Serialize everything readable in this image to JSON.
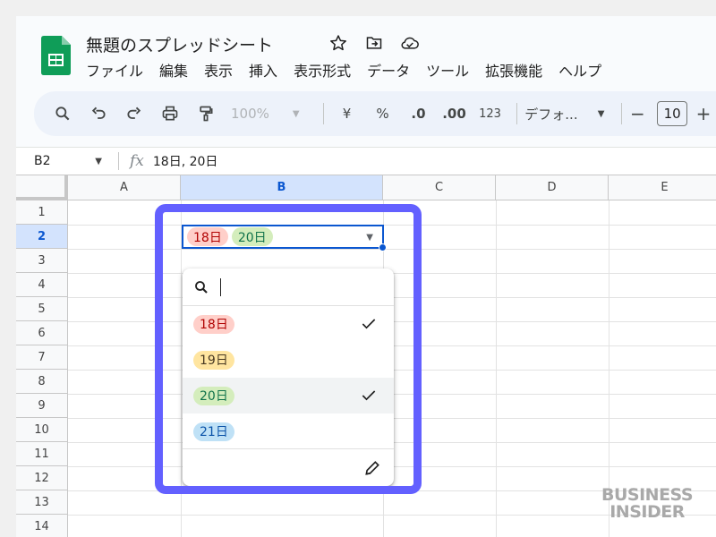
{
  "app": {
    "title": "無題のスプレッドシート",
    "menu": [
      "ファイル",
      "編集",
      "表示",
      "挿入",
      "表示形式",
      "データ",
      "ツール",
      "拡張機能",
      "ヘルプ"
    ]
  },
  "toolbar": {
    "zoom": "100%",
    "currency": "¥",
    "percent": "%",
    "dec_decrease": ".0",
    "dec_increase": ".00",
    "number_format": "123",
    "font": "デフォ...",
    "font_size": "10",
    "minus": "−",
    "plus": "+"
  },
  "formula_bar": {
    "cell_ref": "B2",
    "fx": "fx",
    "value": "18日, 20日"
  },
  "grid": {
    "columns": [
      "A",
      "B",
      "C",
      "D",
      "E"
    ],
    "rows": [
      "1",
      "2",
      "3",
      "4",
      "5",
      "6",
      "7",
      "8",
      "9",
      "10",
      "11",
      "12",
      "13",
      "14"
    ],
    "selected_column": "B",
    "selected_row": "2"
  },
  "cell_b2": {
    "chips": [
      "18日",
      "20日"
    ]
  },
  "dropdown": {
    "options": [
      {
        "label": "18日",
        "color": "#ffcfc9",
        "checked": true
      },
      {
        "label": "19日",
        "color": "#ffe5a0",
        "checked": false
      },
      {
        "label": "20日",
        "color": "#d4edbc",
        "checked": true
      },
      {
        "label": "21日",
        "color": "#bfe1f6",
        "checked": false
      }
    ]
  },
  "colors": {
    "accent": "#0b57d0",
    "highlight_frame": "#6360ff",
    "sheets_green": "#0f9d58"
  },
  "watermark": {
    "line1": "BUSINESS",
    "line2": "INSIDER"
  }
}
